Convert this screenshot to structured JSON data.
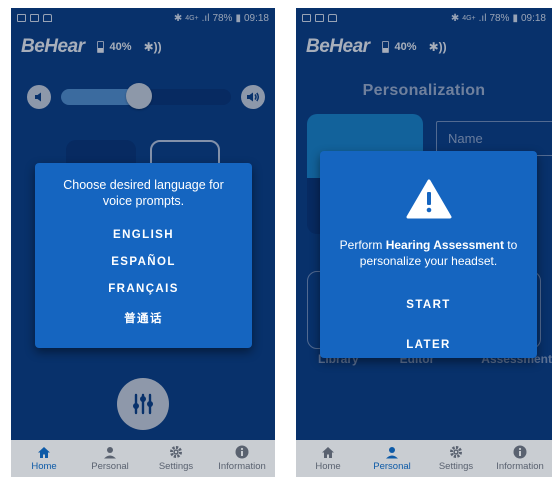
{
  "status": {
    "signal": "4G+",
    "battery": "78%",
    "time": "09:18"
  },
  "app": {
    "logo": "BeHear",
    "battery_level": "40%"
  },
  "home": {
    "volume": {
      "level": 0.46
    },
    "language_dialog": {
      "prompt": "Choose desired language for voice prompts.",
      "options": [
        "ENGLISH",
        "ESPAÑOL",
        "FRANÇAIS",
        "普通话"
      ]
    }
  },
  "personal": {
    "title": "Personalization",
    "name_placeholder": "Name",
    "tools": [
      "Library",
      "Editor",
      "Assessment"
    ],
    "assessment_dialog": {
      "text_before": "Perform ",
      "text_bold": "Hearing Assessment",
      "text_after": " to personalize your headset.",
      "start_label": "START",
      "later_label": "LATER"
    }
  },
  "nav": {
    "items": [
      "Home",
      "Personal",
      "Settings",
      "Information"
    ]
  },
  "colors": {
    "background": "#0b3f86",
    "dialog": "#1565c0",
    "accent": "#5a98d6",
    "nav_active": "#0d5aa7"
  }
}
